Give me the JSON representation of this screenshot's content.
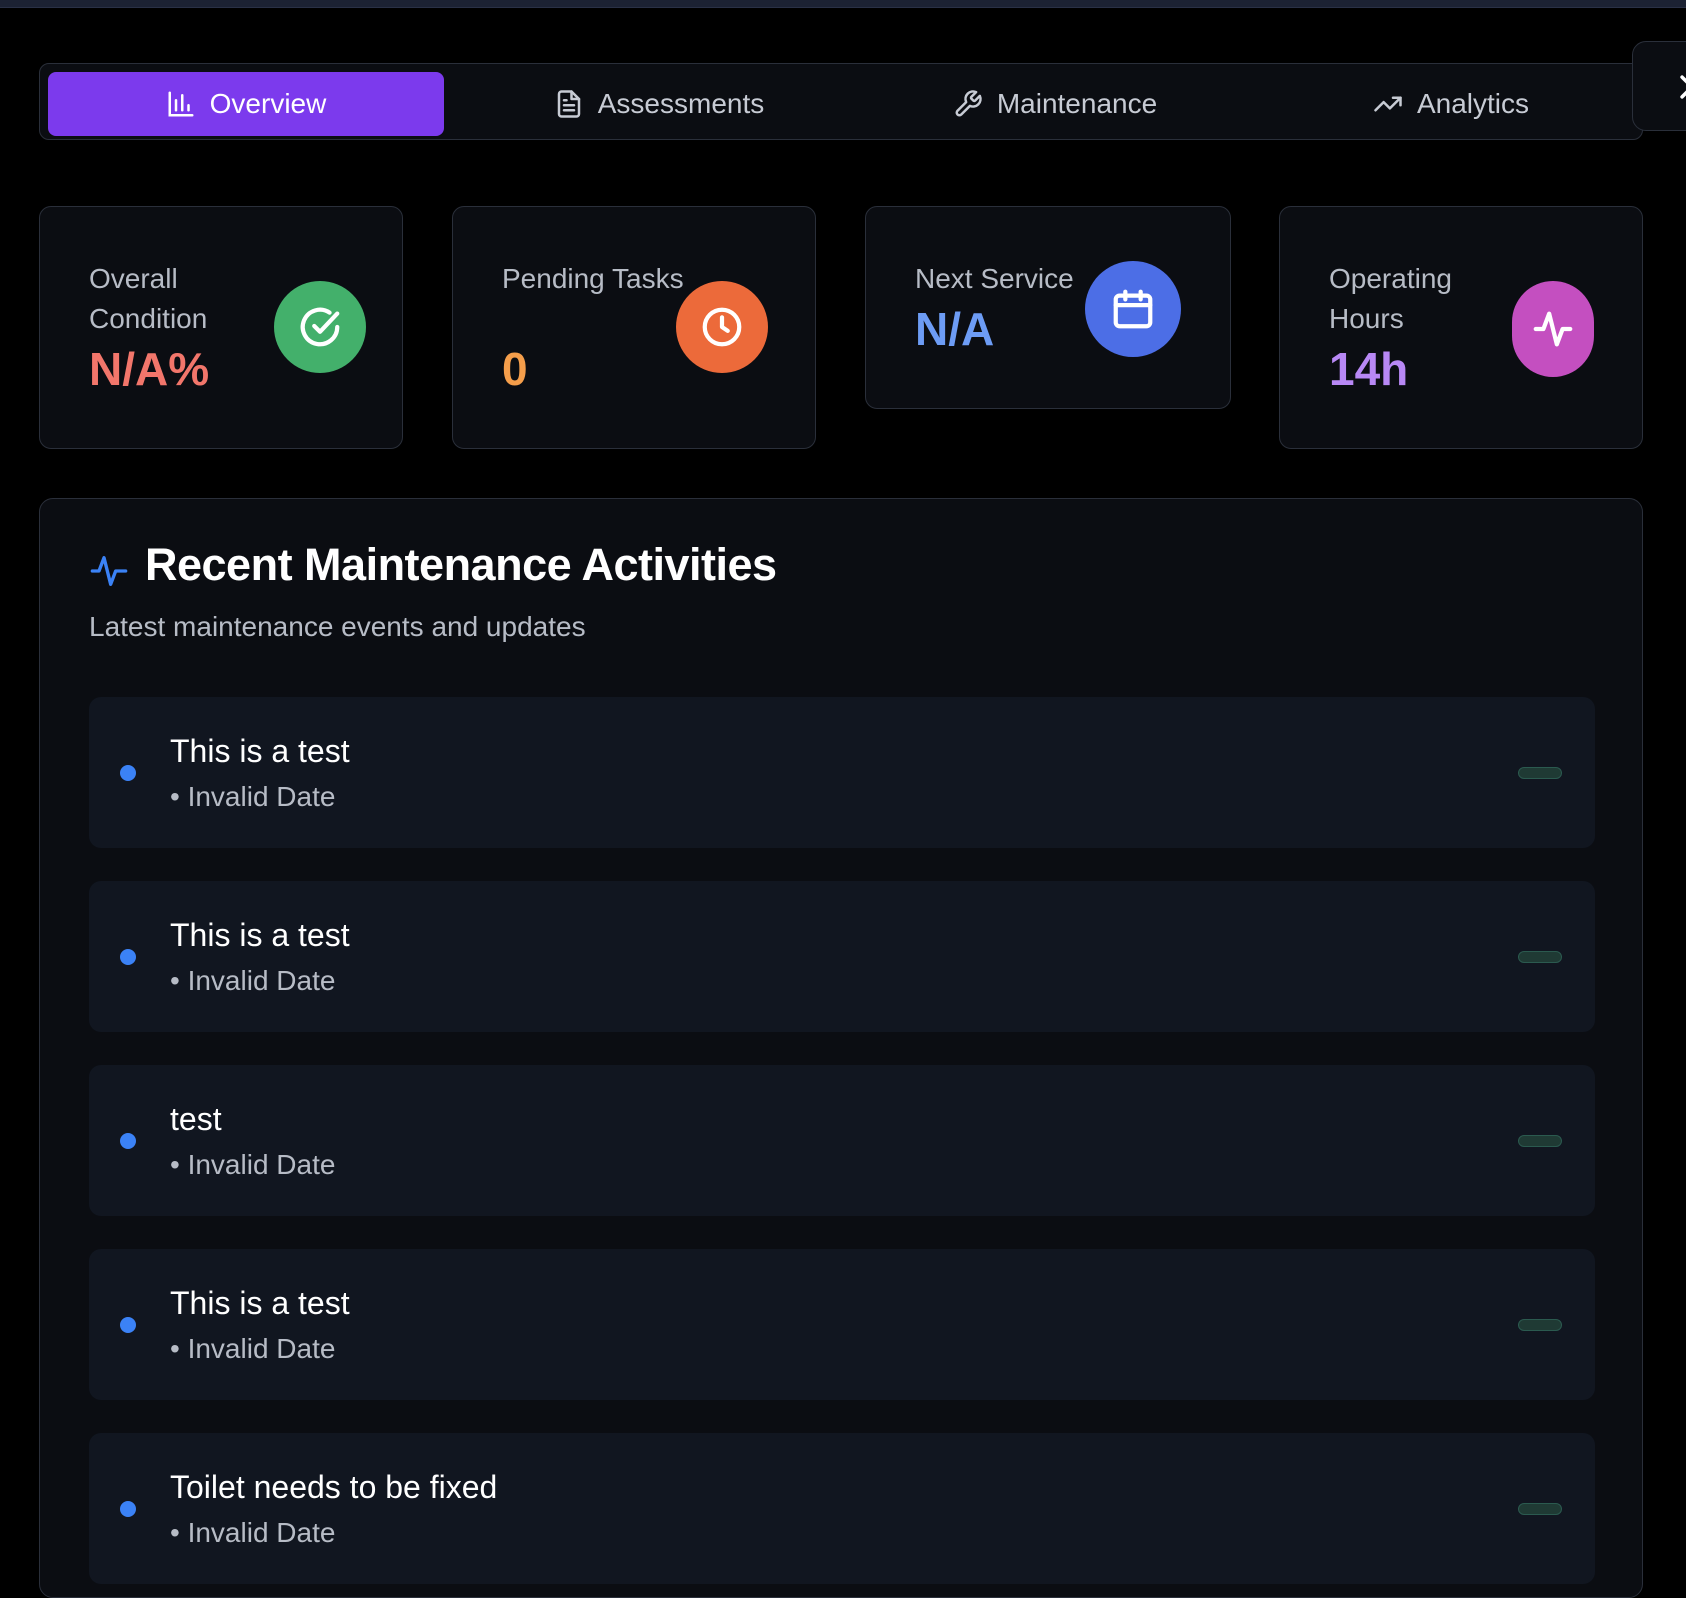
{
  "tabs": [
    {
      "label": "Overview",
      "icon": "bar-chart-icon",
      "active": true
    },
    {
      "label": "Assessments",
      "icon": "document-icon",
      "active": false
    },
    {
      "label": "Maintenance",
      "icon": "wrench-icon",
      "active": false
    },
    {
      "label": "Analytics",
      "icon": "trending-up-icon",
      "active": false
    }
  ],
  "stats": [
    {
      "label": "Overall Condition",
      "value": "N/A%",
      "color": "#f2766b",
      "icon": "check-circle-icon",
      "icon_bg": "#43b06b"
    },
    {
      "label": "Pending Tasks",
      "value": "0",
      "color": "#f59e4b",
      "icon": "clock-icon",
      "icon_bg": "#ec6a3a"
    },
    {
      "label": "Next Service",
      "value": "N/A",
      "color": "#6d9cf5",
      "icon": "calendar-icon",
      "icon_bg": "#4c6ee6"
    },
    {
      "label": "Operating Hours",
      "value": "14h",
      "color": "#b888f5",
      "icon": "activity-icon",
      "icon_bg": "#c44fc0"
    }
  ],
  "activities": {
    "title": "Recent Maintenance Activities",
    "subtitle": "Latest maintenance events and updates",
    "items": [
      {
        "title": "This is a test",
        "meta": "• Invalid Date"
      },
      {
        "title": "This is a test",
        "meta": "• Invalid Date"
      },
      {
        "title": "test",
        "meta": "• Invalid Date"
      },
      {
        "title": "This is a test",
        "meta": "• Invalid Date"
      },
      {
        "title": "Toilet needs to be fixed",
        "meta": "• Invalid Date"
      }
    ]
  },
  "colors": {
    "accent": "#7c3aed",
    "dot": "#3b82f6"
  }
}
